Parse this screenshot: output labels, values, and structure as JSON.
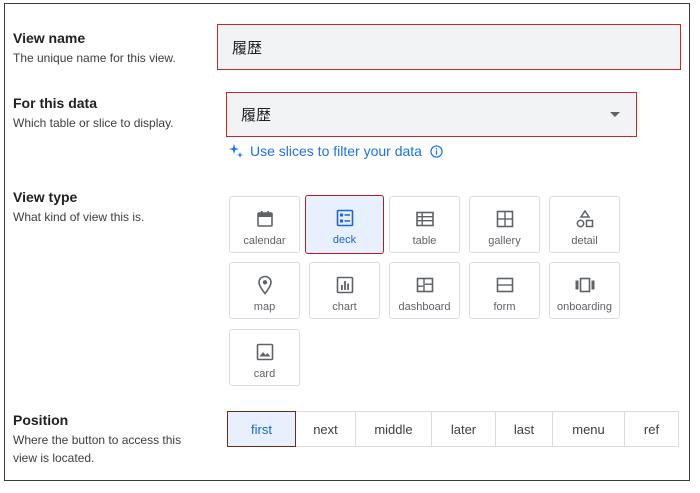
{
  "view_name": {
    "title": "View name",
    "description": "The unique name for this view.",
    "value": "履歴"
  },
  "for_this_data": {
    "title": "For this data",
    "description": "Which table or slice to display.",
    "value": "履歴",
    "slices_link": "Use slices to filter your data"
  },
  "view_type": {
    "title": "View type",
    "description": "What kind of view this is.",
    "options": [
      {
        "label": "calendar",
        "icon": "calendar-icon"
      },
      {
        "label": "deck",
        "icon": "deck-icon"
      },
      {
        "label": "table",
        "icon": "table-icon"
      },
      {
        "label": "gallery",
        "icon": "gallery-icon"
      },
      {
        "label": "detail",
        "icon": "detail-icon"
      },
      {
        "label": "map",
        "icon": "map-pin-icon"
      },
      {
        "label": "chart",
        "icon": "chart-icon"
      },
      {
        "label": "dashboard",
        "icon": "dashboard-icon"
      },
      {
        "label": "form",
        "icon": "form-icon"
      },
      {
        "label": "onboarding",
        "icon": "onboarding-icon"
      },
      {
        "label": "card",
        "icon": "image-icon"
      }
    ],
    "selected": "deck"
  },
  "position": {
    "title": "Position",
    "description_line1": "Where the button to access this",
    "description_line2": "view is located.",
    "options": [
      "first",
      "next",
      "middle",
      "later",
      "last",
      "menu",
      "ref"
    ],
    "selected": "first"
  },
  "colors": {
    "accent": "#1a73e8",
    "highlight_border": "#c62828",
    "selected_bg": "#e8f0fe"
  }
}
